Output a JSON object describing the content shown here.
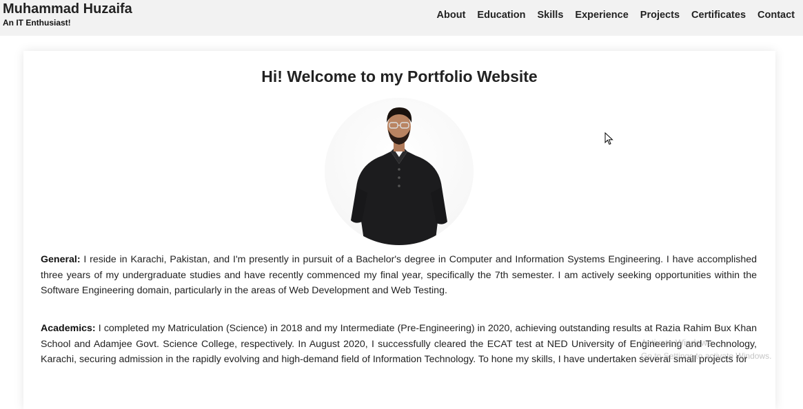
{
  "header": {
    "name": "Muhammad Huzaifa",
    "tagline": "An IT Enthusiast!",
    "nav": [
      "About",
      "Education",
      "Skills",
      "Experience",
      "Projects",
      "Certificates",
      "Contact"
    ]
  },
  "main": {
    "title": "Hi! Welcome to my Portfolio Website",
    "general_label": "General:",
    "general_text": " I reside in Karachi, Pakistan, and I'm presently in pursuit of a Bachelor's degree in Computer and Information Systems Engineering. I have accomplished three years of my undergraduate studies and have recently commenced my final year, specifically the 7th semester. I am actively seeking opportunities within the Software Engineering domain, particularly in the areas of Web Development and Web Testing.",
    "academics_label": "Academics:",
    "academics_text": " I completed my Matriculation (Science) in 2018 and my Intermediate (Pre-Engineering) in 2020, achieving outstanding results at Razia Rahim Bux Khan School and Adamjee Govt. Science College, respectively. In August 2020, I successfully cleared the ECAT test at NED University of Engineering and Technology, Karachi, securing admission in the rapidly evolving and high-demand field of Information Technology. To hone my skills, I have undertaken several small projects for"
  },
  "watermark": {
    "line1": "Activate Windows",
    "line2": "Go to Settings to activate Windows."
  },
  "colors": {
    "header_bg": "#f2f2f2",
    "text": "#222222",
    "shirt": "#1c1c1e"
  }
}
